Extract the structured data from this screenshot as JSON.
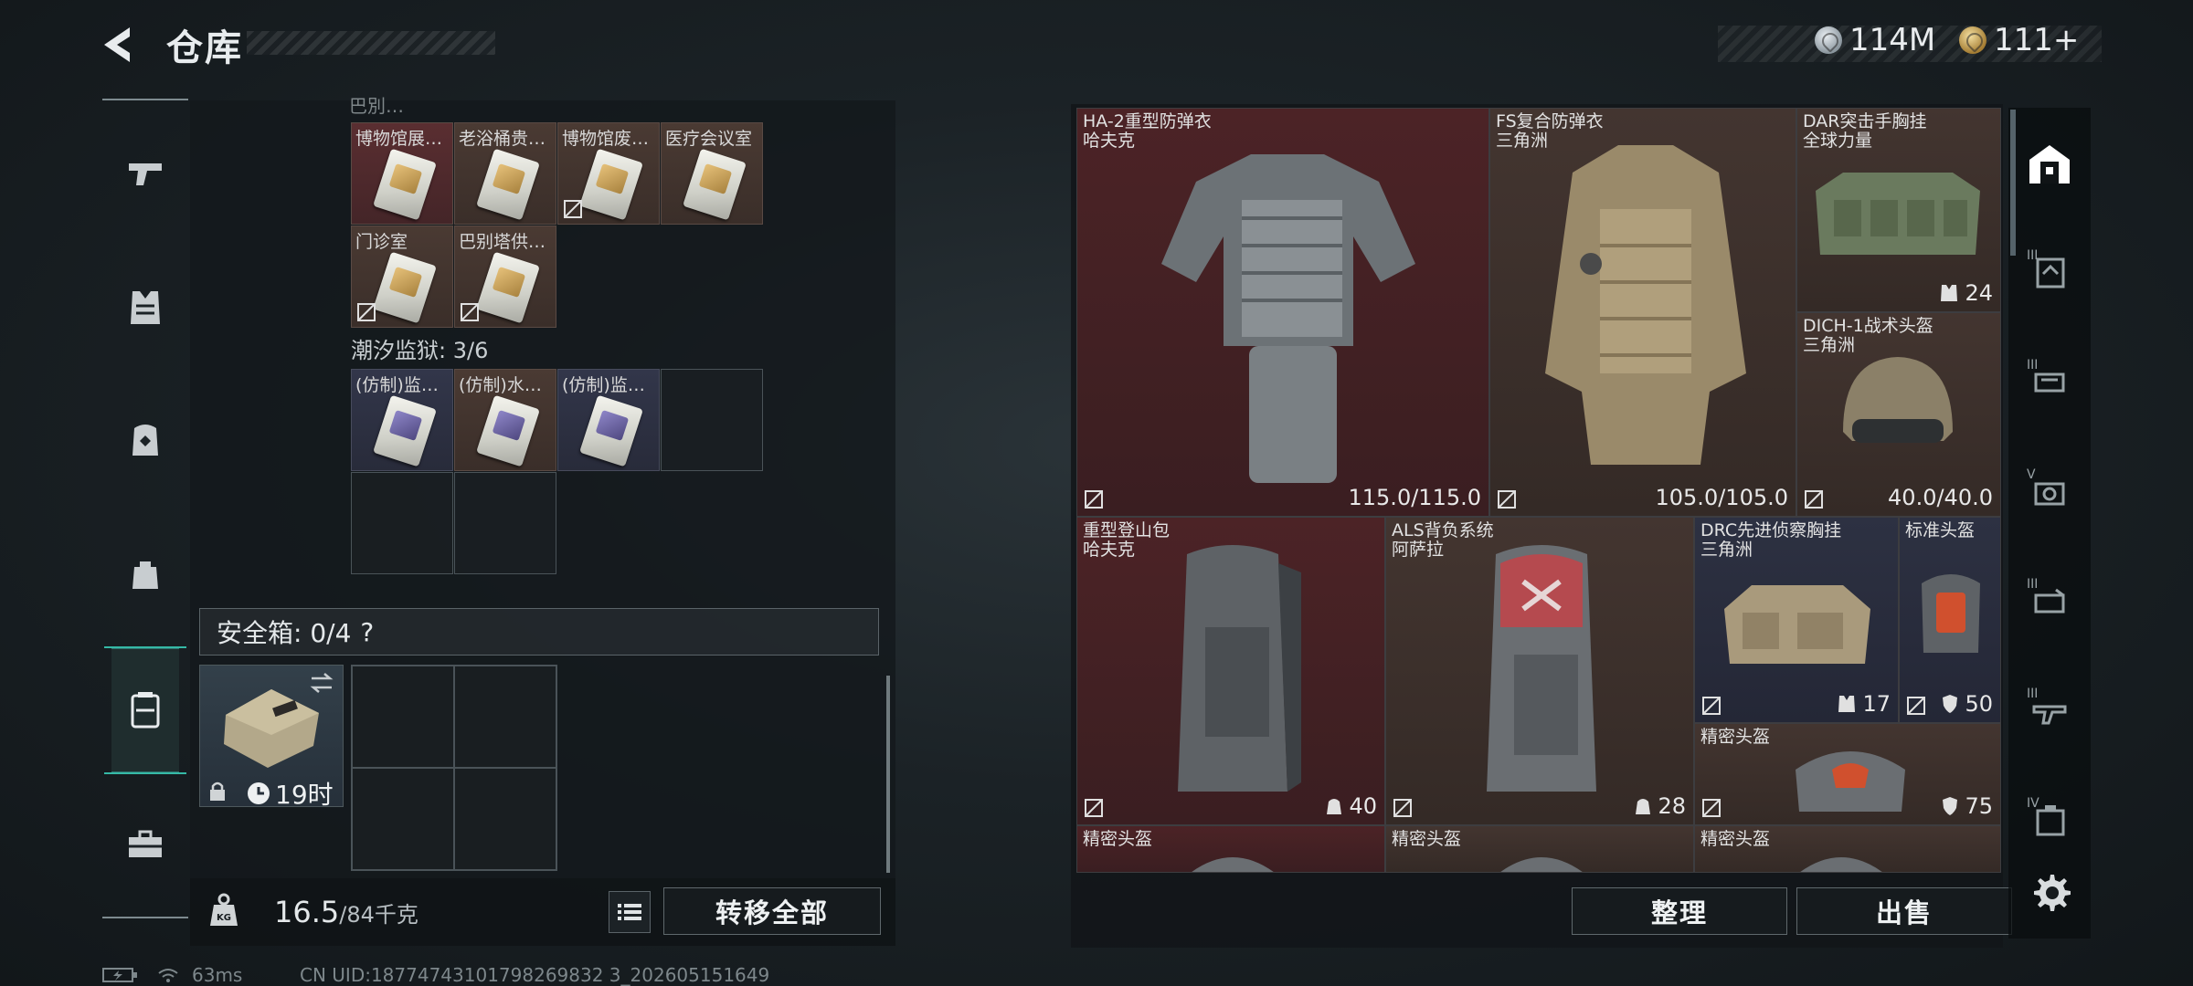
{
  "header": {
    "title": "仓库"
  },
  "currency": {
    "silver": "114M",
    "gold": "111+"
  },
  "stash": {
    "items_row1": [
      "博物馆展…",
      "老浴桶贵…",
      "博物馆废…",
      "医疗会议室"
    ],
    "items_row2": [
      "门诊室",
      "巴别塔供…"
    ],
    "prison_label": "潮汐监狱: 3/6",
    "prison_items": [
      "(仿制)监…",
      "(仿制)水…",
      "(仿制)监…"
    ],
    "safe_label": "安全箱: 0/4",
    "safe_help": "?",
    "safe_timer": "19时",
    "weight_value": "16.5",
    "weight_suffix": "/84千克",
    "transfer_all": "转移全部"
  },
  "loadout": {
    "armor1": {
      "name": "HA-2重型防弹衣",
      "maker": "哈夫克",
      "durability": "115.0/115.0"
    },
    "armor2": {
      "name": "FS复合防弹衣",
      "maker": "三角洲",
      "durability": "105.0/105.0"
    },
    "rig1": {
      "name": "DAR突击手胸挂",
      "maker": "全球力量",
      "capacity": "24"
    },
    "helmet1": {
      "name": "DICH-1战术头盔",
      "maker": "三角洲",
      "durability": "40.0/40.0"
    },
    "bag1": {
      "name": "重型登山包",
      "maker": "哈夫克",
      "capacity": "40"
    },
    "bag2": {
      "name": "ALS背负系统",
      "maker": "阿萨拉",
      "capacity": "28"
    },
    "rig2": {
      "name": "DRC先进侦察胸挂",
      "maker": "三角洲",
      "capacity": "17"
    },
    "helmet2": {
      "name": "标准头盔",
      "value": "50"
    },
    "helmet3": {
      "name": "精密头盔",
      "value": "75"
    },
    "row4": [
      "精密头盔",
      "精密头盔",
      "精密头盔"
    ],
    "sort_button": "整理",
    "sell_button": "出售"
  },
  "rail_levels": [
    "III",
    "III",
    "V",
    "III",
    "III",
    "IV"
  ],
  "status_bar": {
    "ping": "63ms",
    "uid": "CN UID:18774743101798269832 3_202605151649"
  },
  "colors": {
    "accent": "#35b9a6",
    "red_slot": "#4c2326",
    "brown_slot": "#433530",
    "navy_slot": "#2d3142"
  }
}
